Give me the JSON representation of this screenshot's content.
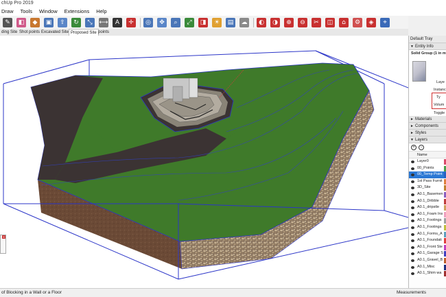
{
  "window": {
    "title": "chUp Pro 2019"
  },
  "menu": [
    "Draw",
    "Tools",
    "Window",
    "Extensions",
    "Help"
  ],
  "toolbar": {
    "icons": [
      "pencil-icon",
      "eraser-icon",
      "paint-icon",
      "cube-icon",
      "push-pull-icon",
      "rotate-icon",
      "scale-icon",
      "tape-icon",
      "text-icon",
      "axes-icon",
      "orbit-icon",
      "pan-icon",
      "zoom-icon",
      "zoom-extents-icon",
      "section-icon",
      "shadow-icon",
      "style-icon",
      "fog-icon",
      "outer-shell-icon",
      "intersect-icon",
      "union-icon",
      "subtract-icon",
      "trim-icon",
      "split-icon",
      "warehouse-icon",
      "extension-icon",
      "ruby-icon",
      "location-icon"
    ],
    "colors": {
      "pencil": "#444444",
      "eraser": "#d05a8a",
      "paint": "#c87830",
      "model": "#4a76b8",
      "solid": "#c83030",
      "misc": "#3a8a3a"
    }
  },
  "scenes": [
    "ding Site",
    "Shot points",
    "Excavated Site",
    "Proposed Site",
    "points"
  ],
  "active_scene": "Proposed Site",
  "status": {
    "message": "of Blocking in a Wall or a Floor",
    "measurements_label": "Measurements"
  },
  "tray": {
    "title": "Default Tray",
    "entity_info": {
      "header": "Entity Info",
      "selection": "Solid Group (1 in m",
      "fields": [
        "Laye",
        "Instanc",
        "Ty",
        "Volum",
        "Toggle"
      ]
    },
    "sections": [
      "Materials",
      "Components",
      "Styles",
      "Layers"
    ],
    "layers_column": "Name",
    "layers": [
      {
        "name": "Layer0",
        "color": "#d94a6a",
        "selected": false
      },
      {
        "name": "00_Points",
        "color": "#4aa04a",
        "selected": false
      },
      {
        "name": "00_Temp Point",
        "color": "#2860c0",
        "selected": true
      },
      {
        "name": "1st Pass Furnit",
        "color": "#e08040",
        "selected": false
      },
      {
        "name": "3D_Site",
        "color": "#c08030",
        "selected": false
      },
      {
        "name": "A0.1_Basemen",
        "color": "#8a60c0",
        "selected": false
      },
      {
        "name": "A0.1_Dribble",
        "color": "#c04040",
        "selected": false
      },
      {
        "name": "A0.1_dripstle",
        "color": "#d0a060",
        "selected": false
      },
      {
        "name": "A0.1_Foam Ins",
        "color": "#f0a0c0",
        "selected": false
      },
      {
        "name": "A0.1_Footings",
        "color": "#a0a0a0",
        "selected": false
      },
      {
        "name": "A0.1_Footings",
        "color": "#c0c040",
        "selected": false
      },
      {
        "name": "A0.1_Forms_A",
        "color": "#60a0c0",
        "selected": false
      },
      {
        "name": "A0.1_Foundati",
        "color": "#e04040",
        "selected": false
      },
      {
        "name": "A0.1_Front Ste",
        "color": "#c040c0",
        "selected": false
      },
      {
        "name": "A0.1_Garage S",
        "color": "#4040c0",
        "selected": false
      },
      {
        "name": "A0.1_Gravel_B",
        "color": "#c06030",
        "selected": false
      },
      {
        "name": "A0.1_Misc",
        "color": "#203080",
        "selected": false
      },
      {
        "name": "A0.1_Shim wa",
        "color": "#a03030",
        "selected": false
      }
    ]
  }
}
